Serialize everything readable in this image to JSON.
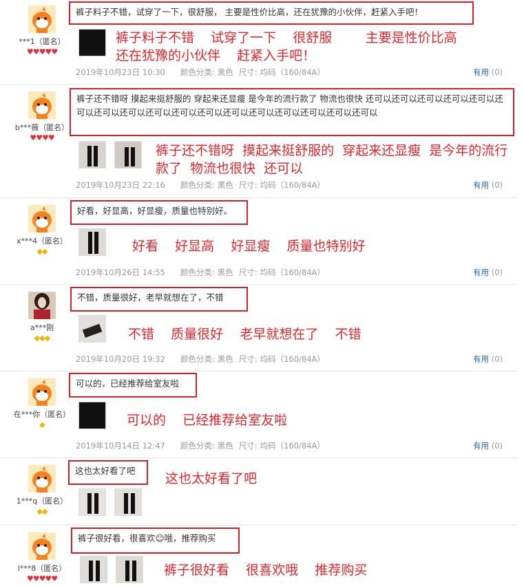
{
  "reviews": [
    {
      "user": "***1（匿名）",
      "rank_type": "heart",
      "rank": "♥♥♥♥♥",
      "avatar": "orange-mascot",
      "text": "裤子料子不错，试穿了一下，很舒服，    主要是性价比高，还在犹豫的小伙伴，赶紧入手吧！",
      "annotation": "裤子料子不错    试穿了一下    很舒服        主要是性价比高\n还在犹豫的小伙伴    赶紧入手吧！",
      "thumbs": [
        "black"
      ],
      "date": "2019年10月23日 10:30",
      "color_label": "颜色分类:",
      "color": "黑色",
      "size_label": "尺寸:",
      "size": "均码（160/84A）",
      "useful_label": "有用",
      "useful_count": "(0)"
    },
    {
      "user": "b***薇（匿名）",
      "rank_type": "heart",
      "rank": "♥♥♥♥",
      "avatar": "orange-mascot",
      "text": "裤子还不错呀 摸起来挺舒服的 穿起来还显瘦 是今年的流行款了 物流也很快 还可以还可以还可以还可以还可以还可以还可以还可以还可以还可以还可以还可以还可以还可以还可以还可以还可以",
      "annotation": "裤子还不错呀  摸起来挺舒服的  穿起来还显瘦  是今年的流行\n款了  物流也很快  还可以",
      "thumbs": [
        "photo",
        "photo"
      ],
      "date": "2019年10月23日 22:16",
      "color_label": "颜色分类:",
      "color": "黑色",
      "size_label": "尺寸:",
      "size": "均码（160/84A）",
      "useful_label": "有用",
      "useful_count": "(0)"
    },
    {
      "user": "x***4（匿名）",
      "rank_type": "diamond",
      "rank": "◆◆",
      "avatar": "orange-mascot",
      "text": "好看，好显高，好显瘦，质量也特别好。",
      "annotation": "好看    好显高    好显瘦    质量也特别好",
      "thumbs": [
        "photo"
      ],
      "date": "2019年10月26日 14:55",
      "color_label": "颜色分类:",
      "color": "黑色",
      "size_label": "尺寸:",
      "size": "均码（160/84A）",
      "useful_label": "有用",
      "useful_count": "(0)"
    },
    {
      "user": "a***刚",
      "rank_type": "diamond",
      "rank": "◆◆◆",
      "avatar": "portrait",
      "text": "不错，质量很好，老早就想在了，不错",
      "annotation": "不错    质量很好    老早就想在了    不错",
      "thumbs": [
        "photo"
      ],
      "date": "2019年10月20日 19:32",
      "color_label": "颜色分类:",
      "color": "黑色",
      "size_label": "尺寸:",
      "size": "均码（160/84A）",
      "useful_label": "有用",
      "useful_count": "(0)"
    },
    {
      "user": "在***你（匿名）",
      "rank_type": "diamond",
      "rank": "◆",
      "avatar": "orange-mascot",
      "text": "可以的，已经推荐给室友啦",
      "annotation": "可以的    已经推荐给室友啦",
      "thumbs": [
        "black"
      ],
      "date": "2019年10月14日 12:47",
      "color_label": "颜色分类:",
      "color": "黑色",
      "size_label": "尺寸:",
      "size": "均码（160/84A）",
      "useful_label": "有用",
      "useful_count": "(0)"
    },
    {
      "user": "1***q（匿名）",
      "rank_type": "diamond",
      "rank": "◆◆",
      "avatar": "orange-mascot",
      "text": "这也太好看了吧",
      "annotation": "这也太好看了吧",
      "thumbs": [
        "photo",
        "photo"
      ]
    },
    {
      "user": "l***8（匿名）",
      "rank_type": "heart",
      "rank": "♥♥♥♥♥",
      "avatar": "orange-mascot",
      "text": "裤子很好看，很喜欢☺哦，推荐购买",
      "annotation": "裤子很好看    很喜欢哦    推荐购买",
      "thumbs": [
        "photo",
        "photo"
      ]
    }
  ]
}
